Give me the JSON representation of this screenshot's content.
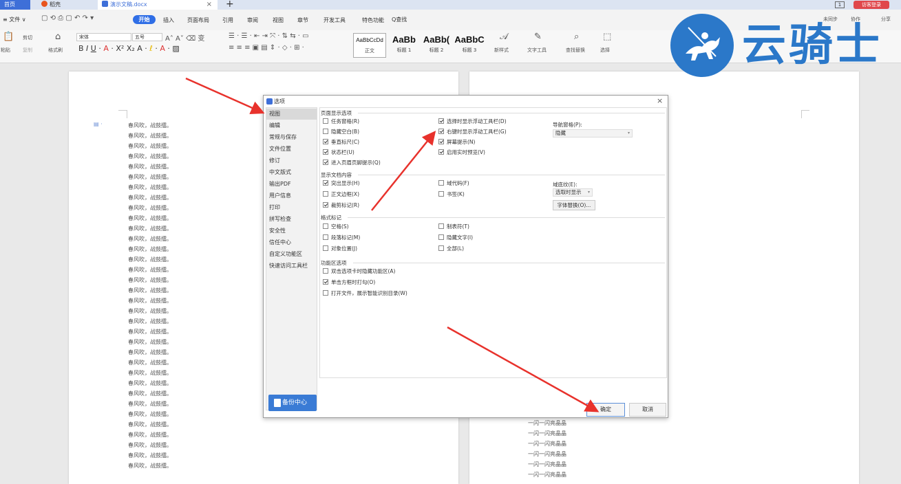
{
  "tabbar": {
    "home_tab": "首页",
    "daoke_tab": "稻壳",
    "doc_tab": "演示文稿.docx",
    "doc_tab_close": "×",
    "new_tab": "+",
    "tab_count": "1",
    "login_button": "访客登录"
  },
  "menu": {
    "file": "≡ 文件 ∨",
    "start": "开始",
    "items": [
      "插入",
      "页面布局",
      "引用",
      "审阅",
      "视图",
      "章节",
      "开发工具",
      "特色功能"
    ],
    "search": "Q查找",
    "sync": "未同步",
    "collab": "协作",
    "share": "分享"
  },
  "toolbar": {
    "paste": "粘贴",
    "cut": "剪切",
    "copy": "复制",
    "format_painter": "格式刷",
    "font_name": "宋体",
    "font_size": "五号",
    "styles": [
      {
        "sample": "AaBbCcDd",
        "name": "正文"
      },
      {
        "sample": "AaBb",
        "name": "标题 1"
      },
      {
        "sample": "AaBb(",
        "name": "标题 2"
      },
      {
        "sample": "AaBbC",
        "name": "标题 3"
      }
    ],
    "new_style": "新样式",
    "text_tools": "文字工具",
    "find_replace": "查找替换",
    "select": "选择"
  },
  "watermark": {
    "text": "云骑士",
    "icon": "knight-rider-icon",
    "color": "#2b78c9"
  },
  "document": {
    "left_line": "春风吹，战鼓擂。",
    "right_line": "一闪一闪亮晶晶"
  },
  "dialog": {
    "title": "选项",
    "close": "×",
    "sidebar": [
      "视图",
      "编辑",
      "常规与保存",
      "文件位置",
      "修订",
      "中文版式",
      "输出PDF",
      "用户信息",
      "打印",
      "拼写检查",
      "安全性",
      "信任中心",
      "自定义功能区",
      "快速访问工具栏"
    ],
    "active_item": "视图",
    "backup_button": "备份中心",
    "groups": {
      "page_display": "页面显示选项",
      "doc_content": "显示文档内容",
      "format_marks": "格式标记",
      "ribbon_options": "功能区选项"
    },
    "page_display_left": [
      {
        "label": "任务窗格(R)",
        "checked": false
      },
      {
        "label": "隐藏空白(B)",
        "checked": false
      },
      {
        "label": "垂直标尺(C)",
        "checked": true
      },
      {
        "label": "状态栏(U)",
        "checked": true
      },
      {
        "label": "进入页眉页脚提示(Q)",
        "checked": true
      }
    ],
    "page_display_right": [
      {
        "label": "选择时显示浮动工具栏(D)",
        "checked": true
      },
      {
        "label": "右键时显示浮动工具栏(G)",
        "checked": true
      },
      {
        "label": "屏幕提示(N)",
        "checked": true
      },
      {
        "label": "启用实时预览(V)",
        "checked": true
      }
    ],
    "nav_pane_label": "导航窗格(P):",
    "nav_pane_value": "隐藏",
    "doc_content_left": [
      {
        "label": "突出显示(H)",
        "checked": true
      },
      {
        "label": "正文边框(X)",
        "checked": false
      },
      {
        "label": "裁剪标记(R)",
        "checked": true
      }
    ],
    "doc_content_right": [
      {
        "label": "域代码(F)",
        "checked": false
      },
      {
        "label": "书签(K)",
        "checked": false
      }
    ],
    "field_shading_label": "域底纹(E):",
    "field_shading_value": "选取时显示",
    "font_substitution_button": "字体替换(O)...",
    "format_marks_left": [
      {
        "label": "空格(S)",
        "checked": false
      },
      {
        "label": "段落标记(M)",
        "checked": false
      },
      {
        "label": "对象位置(J)",
        "checked": false
      }
    ],
    "format_marks_right": [
      {
        "label": "制表符(T)",
        "checked": false
      },
      {
        "label": "隐藏文字(I)",
        "checked": false
      },
      {
        "label": "全部(L)",
        "checked": false
      }
    ],
    "ribbon_options_list": [
      {
        "label": "双击选项卡时隐藏功能区(A)",
        "checked": false
      },
      {
        "label": "单击方框时打勾(O)",
        "checked": true
      },
      {
        "label": "打开文件，展示智能识别目录(W)",
        "checked": false
      }
    ],
    "ok_button": "确定",
    "cancel_button": "取消"
  },
  "colors": {
    "accent": "#2f6ee6",
    "arrow": "#e8322c",
    "login": "#e0474c"
  }
}
